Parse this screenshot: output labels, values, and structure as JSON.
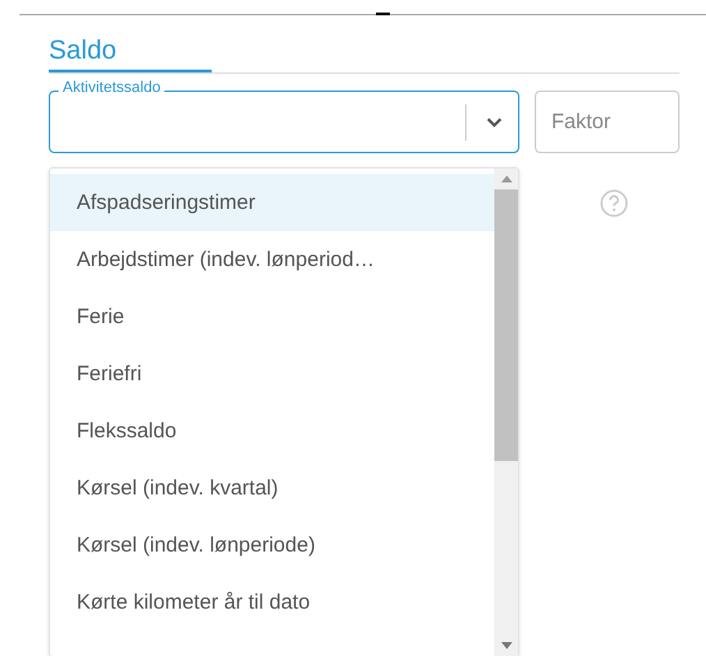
{
  "section": {
    "title": "Saldo"
  },
  "balance_field": {
    "label": "Aktivitetssaldo",
    "focused": true
  },
  "factor_field": {
    "placeholder": "Faktor"
  },
  "dropdown": {
    "items": [
      {
        "label": "Afspadseringstimer",
        "selected": true
      },
      {
        "label": "Arbejdstimer (indev. lønperiod…",
        "selected": false
      },
      {
        "label": "Ferie",
        "selected": false
      },
      {
        "label": "Feriefri",
        "selected": false
      },
      {
        "label": "Flekssaldo",
        "selected": false
      },
      {
        "label": "Kørsel (indev. kvartal)",
        "selected": false
      },
      {
        "label": "Kørsel (indev. lønperiode)",
        "selected": false
      },
      {
        "label": "Kørte kilometer år til dato",
        "selected": false
      }
    ]
  }
}
